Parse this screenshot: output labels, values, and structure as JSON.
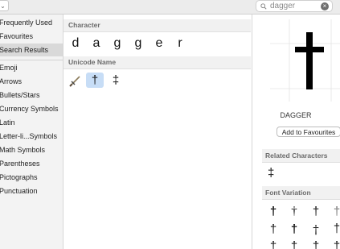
{
  "search": {
    "value": "dagger",
    "clear_icon": "clear-icon"
  },
  "sidebar": {
    "items": [
      {
        "label": "Frequently Used"
      },
      {
        "label": "Favourites"
      },
      {
        "label": "Search Results"
      },
      {
        "label": "Emoji"
      },
      {
        "label": "Arrows"
      },
      {
        "label": "Bullets/Stars"
      },
      {
        "label": "Currency Symbols"
      },
      {
        "label": "Latin"
      },
      {
        "label": "Letter-li...Symbols"
      },
      {
        "label": "Math Symbols"
      },
      {
        "label": "Parentheses"
      },
      {
        "label": "Pictographs"
      },
      {
        "label": "Punctuation"
      }
    ],
    "selected": "Search Results"
  },
  "main": {
    "character_header": "Character",
    "characters": [
      "d",
      "a",
      "g",
      "g",
      "e",
      "r"
    ],
    "unicode_header": "Unicode Name",
    "unicode_results": [
      "🗡",
      "†",
      "‡"
    ],
    "selected_result": "†"
  },
  "detail": {
    "preview_glyph": "†",
    "name": "DAGGER",
    "favourite_button": "Add to Favourites",
    "related_header": "Related Characters",
    "related_chars": [
      "‡"
    ],
    "font_variation_header": "Font Variation",
    "font_variations": [
      "†",
      "†",
      "†",
      "†",
      "†",
      "†",
      "†",
      "†",
      "†",
      "†",
      "†",
      "†"
    ]
  }
}
